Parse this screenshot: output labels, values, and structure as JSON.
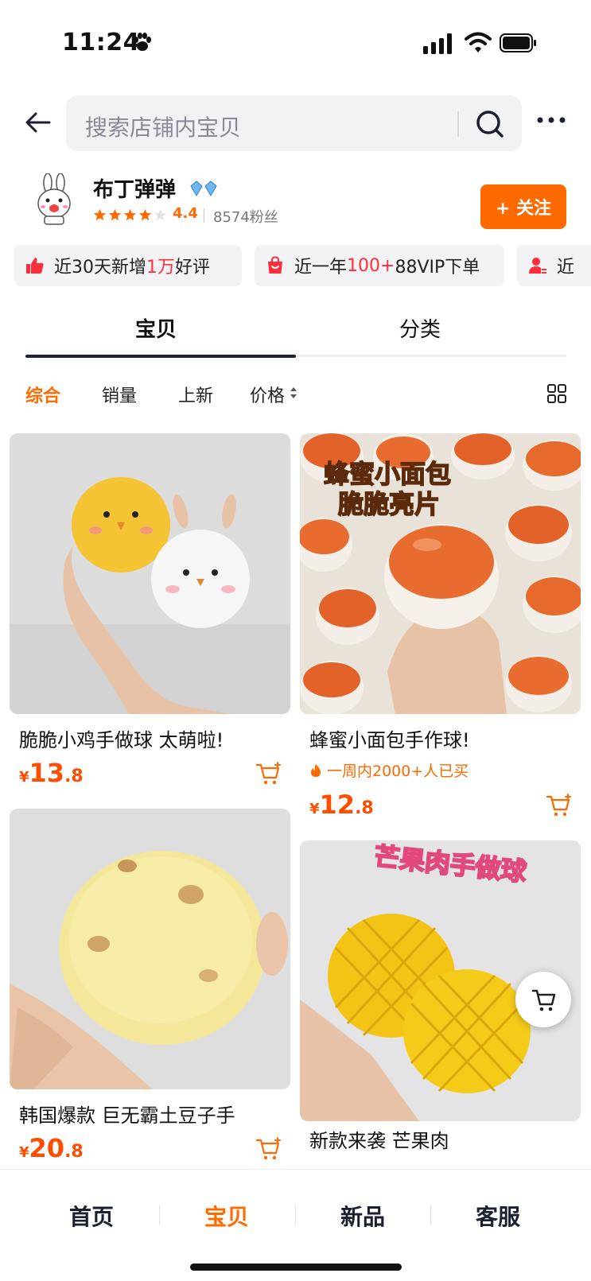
{
  "status": {
    "time": "11:24"
  },
  "search": {
    "placeholder": "搜索店铺内宝贝"
  },
  "shop": {
    "name": "布丁弹弹",
    "rating": "4.4",
    "fans": "8574粉丝",
    "follow_label": "+ 关注",
    "stars": 4
  },
  "chips": [
    {
      "icon": "thumbs-up-icon",
      "pre": "近30天新增",
      "highlight": "1万",
      "post": "好评"
    },
    {
      "icon": "shopping-bag-icon",
      "pre": "近一年",
      "highlight": "100+",
      "post": "88VIP下单"
    },
    {
      "icon": "user-icon",
      "pre": "近",
      "highlight": "",
      "post": ""
    }
  ],
  "tabs": [
    {
      "label": "宝贝",
      "active": true
    },
    {
      "label": "分类",
      "active": false
    }
  ],
  "sorts": [
    {
      "label": "综合",
      "active": true
    },
    {
      "label": "销量",
      "active": false
    },
    {
      "label": "上新",
      "active": false
    },
    {
      "label": "价格",
      "active": false
    }
  ],
  "products": [
    {
      "title": "脆脆小鸡手做球 太萌啦!",
      "currency": "¥",
      "price_int": "13",
      "price_dec": ".8",
      "sub": ""
    },
    {
      "title": "蜂蜜小面包手作球!",
      "currency": "¥",
      "price_int": "12",
      "price_dec": ".8",
      "sub": "一周内2000+人已买",
      "overlay": [
        "蜂蜜小面包",
        "脆脆亮片"
      ]
    },
    {
      "title": "韩国爆款 巨无霸土豆子手",
      "currency": "¥",
      "price_int": "20",
      "price_dec": ".8",
      "sub": ""
    },
    {
      "title": "新款来袭 芒果肉",
      "currency": "¥",
      "price_int": "",
      "price_dec": "",
      "sub": "",
      "overlay": [
        "芒果肉手做球"
      ]
    }
  ],
  "bottom_nav": [
    {
      "label": "首页",
      "active": false
    },
    {
      "label": "宝贝",
      "active": true
    },
    {
      "label": "新品",
      "active": false
    },
    {
      "label": "客服",
      "active": false
    }
  ],
  "colors": {
    "accent": "#ff6a00",
    "price": "#ff4d00",
    "highlight": "#ff2e3d",
    "dark": "#1f2433"
  }
}
